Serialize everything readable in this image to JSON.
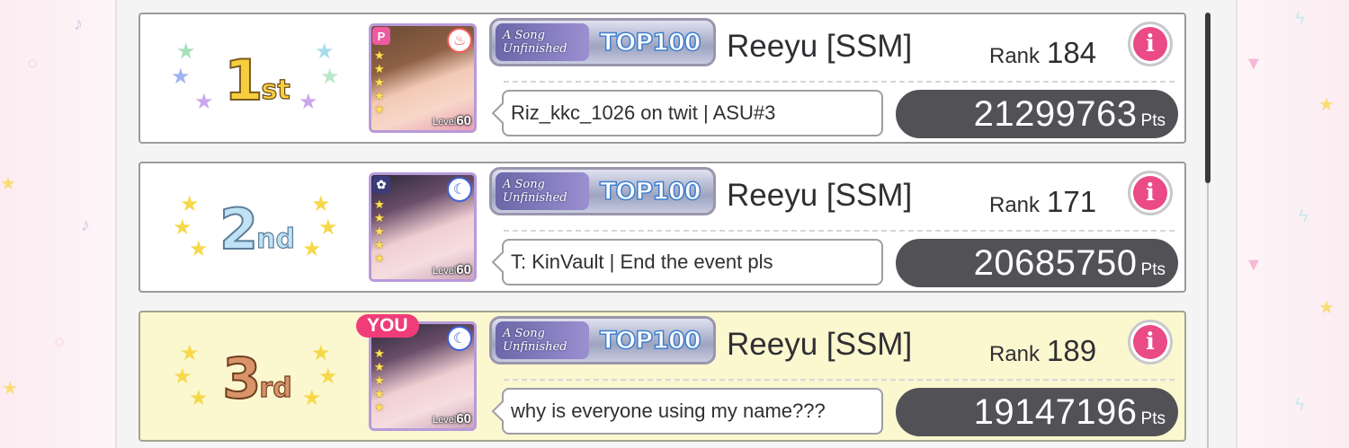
{
  "entries": [
    {
      "place_number": "1",
      "place_suffix": "st",
      "is_you": false,
      "card": {
        "band_badge": "P",
        "attribute_icon": "flame-icon",
        "level_label": "Level",
        "level_value": "60",
        "stars": 5
      },
      "title": {
        "song": [
          "A Song",
          "Unfinished"
        ],
        "top_label": "TOP100"
      },
      "player_name": "Reeyu [SSM]",
      "rank_label": "Rank",
      "rank": "184",
      "comment": "Riz_kkc_1026  on  twit | ASU#3",
      "points": "21299763",
      "points_unit": "Pts"
    },
    {
      "place_number": "2",
      "place_suffix": "nd",
      "is_you": false,
      "card": {
        "band_badge": "✿",
        "attribute_icon": "moon-icon",
        "level_label": "Level",
        "level_value": "60",
        "stars": 5
      },
      "title": {
        "song": [
          "A Song",
          "Unfinished"
        ],
        "top_label": "TOP100"
      },
      "player_name": "Reeyu [SSM]",
      "rank_label": "Rank",
      "rank": "171",
      "comment": "T: KinVault | End the event pls",
      "points": "20685750",
      "points_unit": "Pts"
    },
    {
      "place_number": "3",
      "place_suffix": "rd",
      "is_you": true,
      "you_label": "YOU",
      "card": {
        "band_badge": "✿",
        "attribute_icon": "moon-icon",
        "level_label": "Level",
        "level_value": "60",
        "stars": 5
      },
      "title": {
        "song": [
          "A Song",
          "Unfinished"
        ],
        "top_label": "TOP100"
      },
      "player_name": "Reeyu [SSM]",
      "rank_label": "Rank",
      "rank": "189",
      "comment": "why is everyone using my name???",
      "points": "19147196",
      "points_unit": "Pts"
    }
  ],
  "colors": {
    "place_1": "#f7cf3e",
    "place_2": "#bfe2f5",
    "place_3": "#d9946a",
    "you_highlight": "#fbf7cf",
    "you_badge": "#f03c78",
    "info_button": "#ea4a86",
    "points_pill": "#525256"
  }
}
